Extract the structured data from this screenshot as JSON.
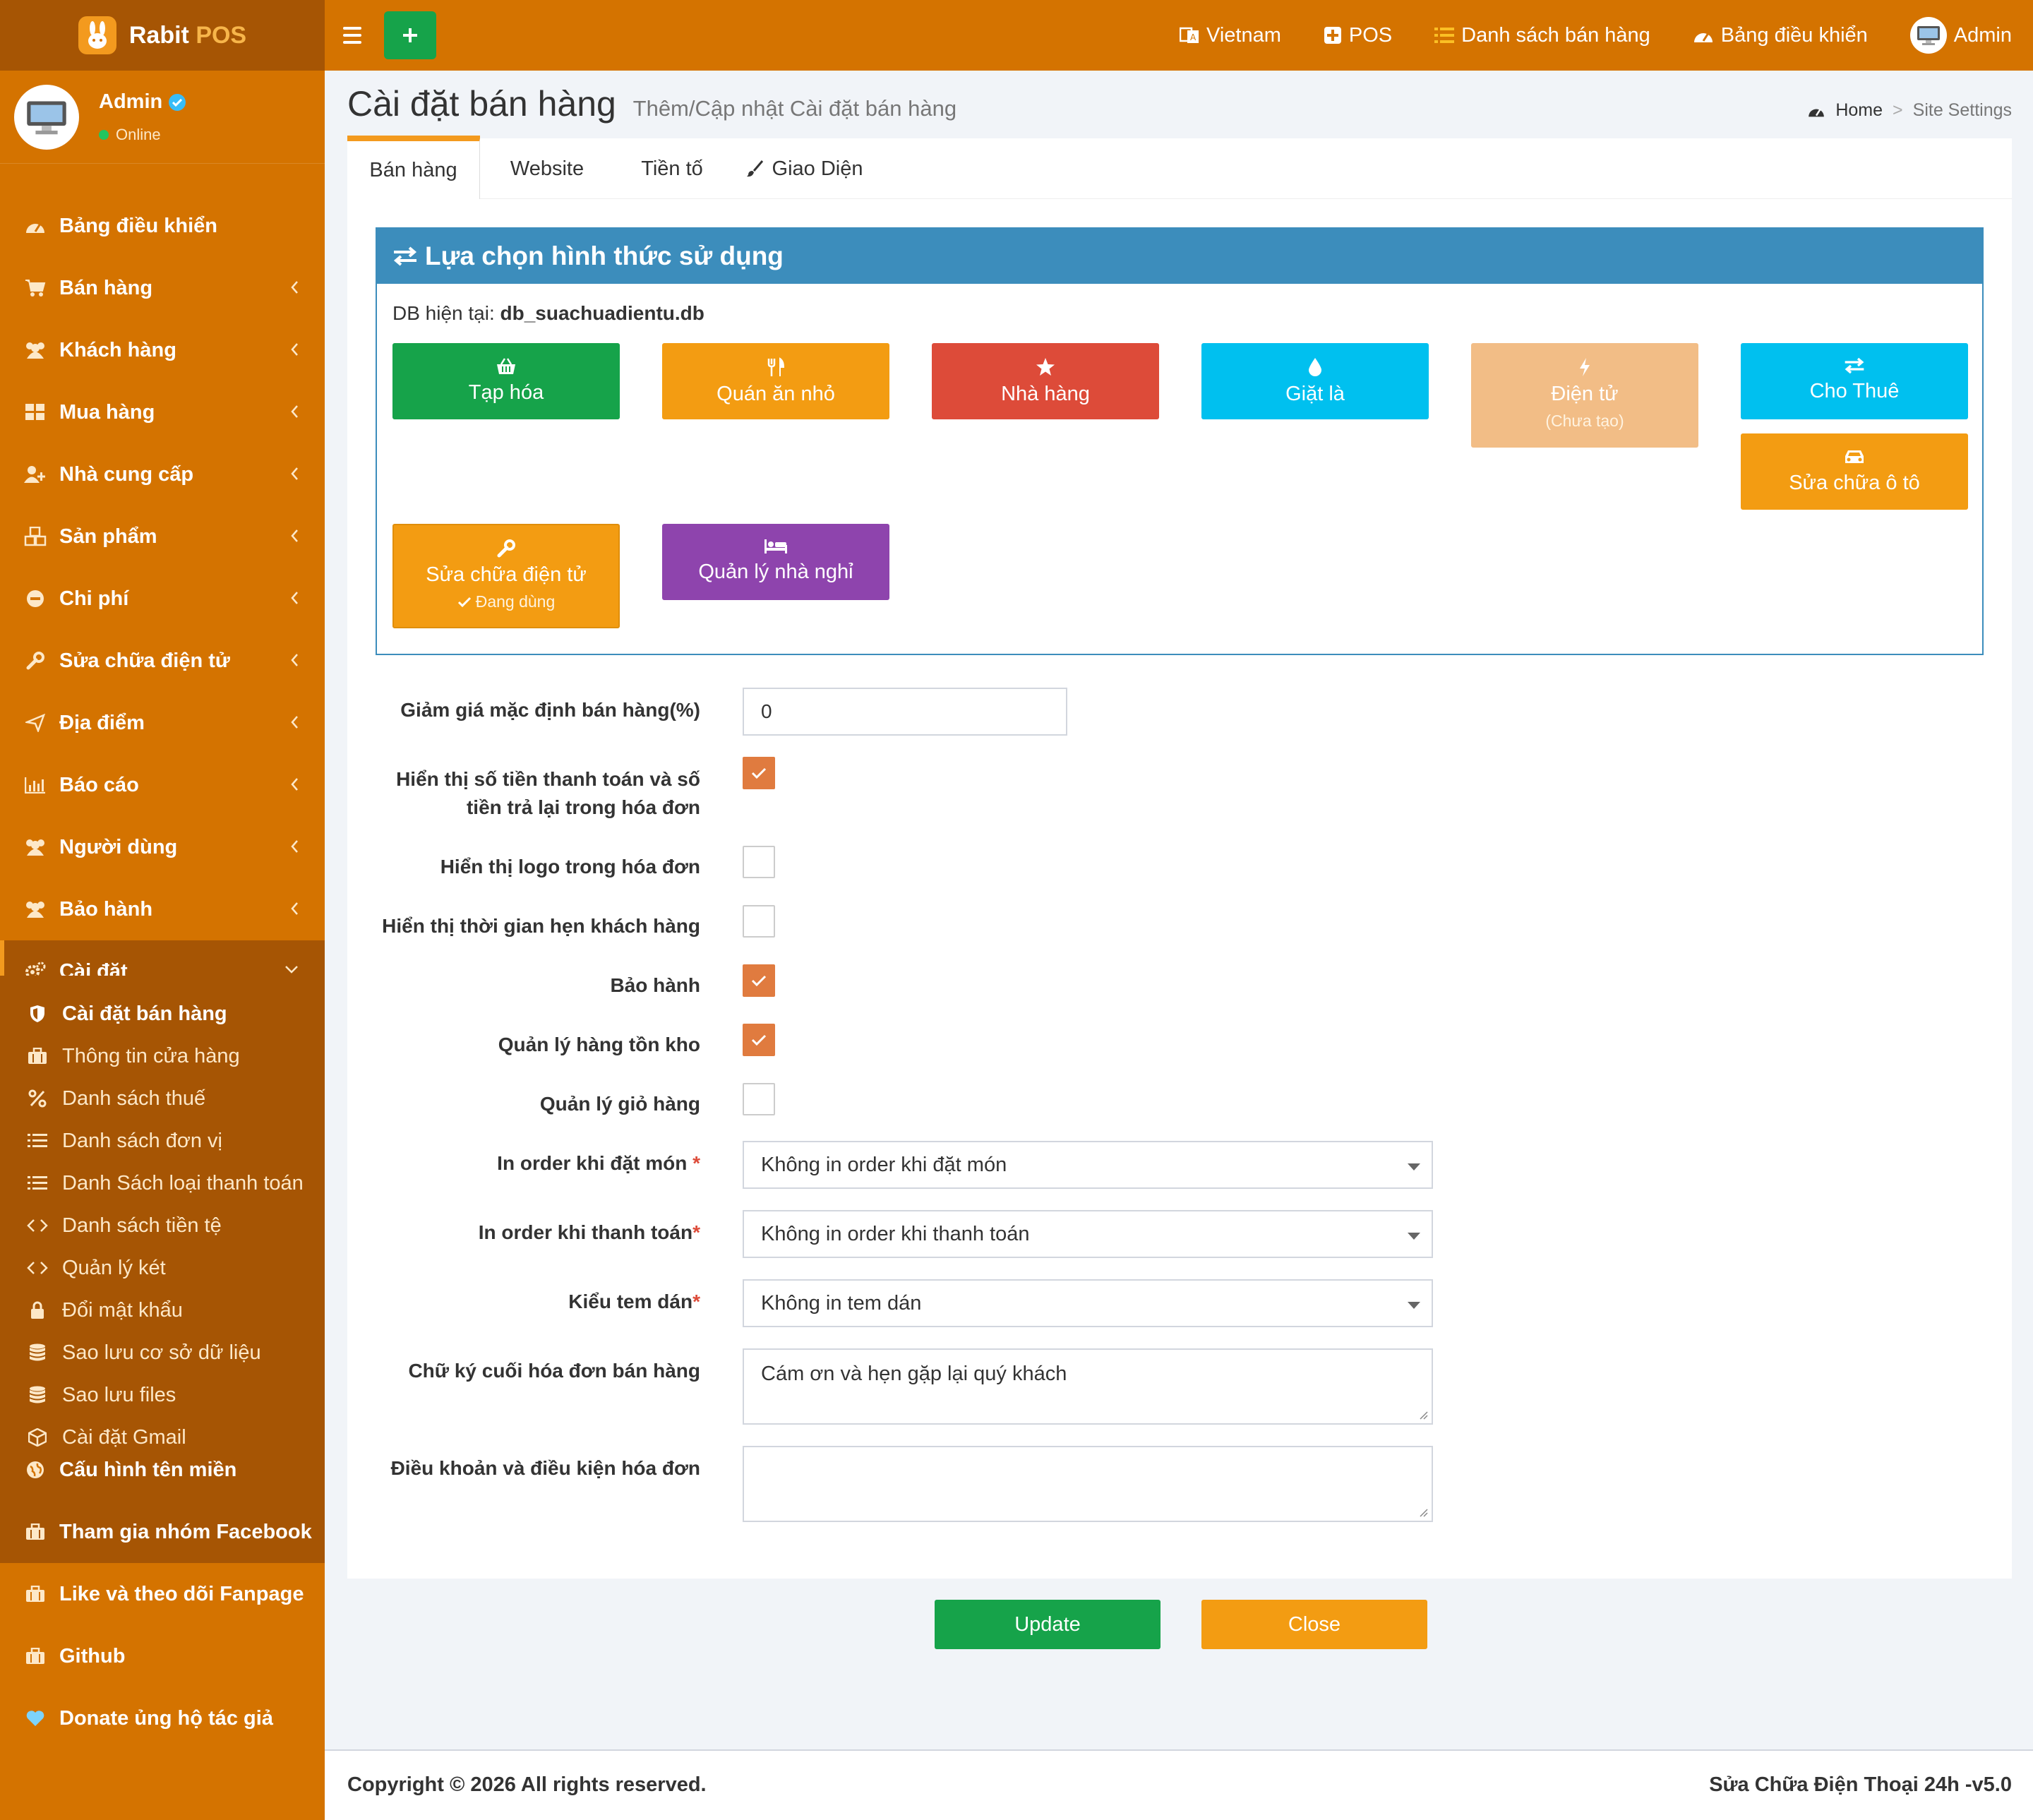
{
  "app": {
    "logo_text": "Rabit",
    "logo_accent": "POS"
  },
  "topnav": {
    "language": "Vietnam",
    "pos": "POS",
    "sales_list": "Danh sách bán hàng",
    "dashboard": "Bảng điều khiển",
    "user": "Admin"
  },
  "user_panel": {
    "name": "Admin",
    "status": "Online"
  },
  "sidebar": {
    "items": [
      {
        "label": "Bảng điều khiển",
        "icon": "dashboard-icon"
      },
      {
        "label": "Bán hàng",
        "icon": "cart-icon"
      },
      {
        "label": "Khách hàng",
        "icon": "users-icon"
      },
      {
        "label": "Mua hàng",
        "icon": "grid-icon"
      },
      {
        "label": "Nhà cung cấp",
        "icon": "user-plus-icon"
      },
      {
        "label": "Sản phẩm",
        "icon": "cubes-icon"
      },
      {
        "label": "Chi phí",
        "icon": "minus-circle-icon"
      },
      {
        "label": "Sửa chữa điện tử",
        "icon": "wrench-icon"
      },
      {
        "label": "Địa điểm",
        "icon": "send-icon"
      },
      {
        "label": "Báo cáo",
        "icon": "bar-chart-icon"
      },
      {
        "label": "Người dùng",
        "icon": "users-icon"
      },
      {
        "label": "Bảo hành",
        "icon": "users-icon"
      },
      {
        "label": "Cài đặt",
        "icon": "cogs-icon"
      }
    ],
    "submenu": [
      {
        "label": "Cài đặt bán hàng",
        "icon": "shield-icon"
      },
      {
        "label": "Thông tin cửa hàng",
        "icon": "briefcase-icon"
      },
      {
        "label": "Danh sách thuế",
        "icon": "percent-icon"
      },
      {
        "label": "Danh sách đơn vị",
        "icon": "list-icon"
      },
      {
        "label": "Danh Sách loại thanh toán",
        "icon": "list-icon"
      },
      {
        "label": "Danh sách tiền tệ",
        "icon": "code-icon"
      },
      {
        "label": "Quản lý két",
        "icon": "code-icon"
      },
      {
        "label": "Đổi mật khẩu",
        "icon": "lock-icon"
      },
      {
        "label": "Sao lưu cơ sở dữ liệu",
        "icon": "database-icon"
      },
      {
        "label": "Sao lưu files",
        "icon": "database-icon"
      },
      {
        "label": "Cài đặt Gmail",
        "icon": "cube-icon"
      }
    ],
    "bottom": [
      {
        "label": "Cấu hình tên miền",
        "icon": "globe-icon"
      },
      {
        "label": "Tham gia nhóm Facebook",
        "icon": "briefcase-icon"
      },
      {
        "label": "Like và theo dõi Fanpage",
        "icon": "briefcase-icon"
      },
      {
        "label": "Github",
        "icon": "briefcase-icon"
      },
      {
        "label": "Donate ủng hộ tác giả",
        "icon": "heart-icon"
      }
    ]
  },
  "header": {
    "title": "Cài đặt bán hàng",
    "subtitle": "Thêm/Cập nhật Cài đặt bán hàng",
    "breadcrumb_home": "Home",
    "breadcrumb_current": "Site Settings"
  },
  "tabs": [
    "Bán hàng",
    "Website",
    "Tiền tố",
    "Giao Diện"
  ],
  "mode_box": {
    "title": "Lựa chọn hình thức sử dụng",
    "db_label": "DB hiện tại:",
    "db_name": "db_suachuadientu.db",
    "modes": [
      {
        "label": "Tạp hóa",
        "icon": "basket-icon",
        "color": "#16a34a"
      },
      {
        "label": "Quán ăn nhỏ",
        "icon": "cutlery-icon",
        "color": "#f39c12"
      },
      {
        "label": "Nhà hàng",
        "icon": "star-icon",
        "color": "#dd4b39"
      },
      {
        "label": "Giặt là",
        "icon": "tint-icon",
        "color": "#00c0ef"
      },
      {
        "label": "Điện tử",
        "sub": "(Chưa tạo)",
        "icon": "bolt-icon",
        "color": "#f2bd86"
      },
      {
        "label": "Cho Thuê",
        "icon": "exchange-icon",
        "color": "#00c0ef"
      },
      {
        "label": "Sửa chữa ô tô",
        "icon": "car-icon",
        "color": "#f39c12"
      },
      {
        "label": "Sửa chữa điện tử",
        "sub": "Đang dùng",
        "icon": "wrench-icon",
        "color": "#f39c12"
      },
      {
        "label": "Quản lý nhà nghỉ",
        "icon": "bed-icon",
        "color": "#8e44ad"
      }
    ]
  },
  "form": {
    "discount_label": "Giảm giá mặc định bán hàng(%)",
    "discount_value": "0",
    "show_payment_label_1": "Hiển thị số tiền thanh toán và số",
    "show_payment_label_2": "tiền trả lại trong hóa đơn",
    "show_payment_checked": true,
    "show_logo_label": "Hiển thị logo trong hóa đơn",
    "show_logo_checked": false,
    "show_appointment_label": "Hiển thị thời gian hẹn khách hàng",
    "show_appointment_checked": false,
    "warranty_label": "Bảo hành",
    "warranty_checked": true,
    "inventory_label": "Quản lý hàng tồn kho",
    "inventory_checked": true,
    "cart_label": "Quản lý giỏ hàng",
    "cart_checked": false,
    "print_order_label": "In order khi đặt món",
    "print_order_value": "Không in order khi đặt món",
    "print_payment_label": "In order khi thanh toán",
    "print_payment_value": "Không in order khi thanh toán",
    "sticker_label": "Kiểu tem dán",
    "sticker_value": "Không in tem dán",
    "signature_label": "Chữ ký cuối hóa đơn bán hàng",
    "signature_value": "Cám ơn và hẹn gặp lại quý khách",
    "terms_label": "Điều khoản và điều kiện hóa đơn",
    "terms_value": "",
    "required_mark": "*"
  },
  "actions": {
    "update": "Update",
    "close": "Close"
  },
  "footer": {
    "copyright": "Copyright © 2026 All rights reserved.",
    "version": "Sửa Chữa Điện Thoại 24h -v5.0"
  },
  "colors": {
    "brand": "#d47300",
    "brand_dark": "#a65504",
    "accent": "#f39a1e",
    "primary_box": "#3c8dbc",
    "success": "#16a34a",
    "warning": "#f39c12",
    "checkbox": "#e07b3f"
  }
}
